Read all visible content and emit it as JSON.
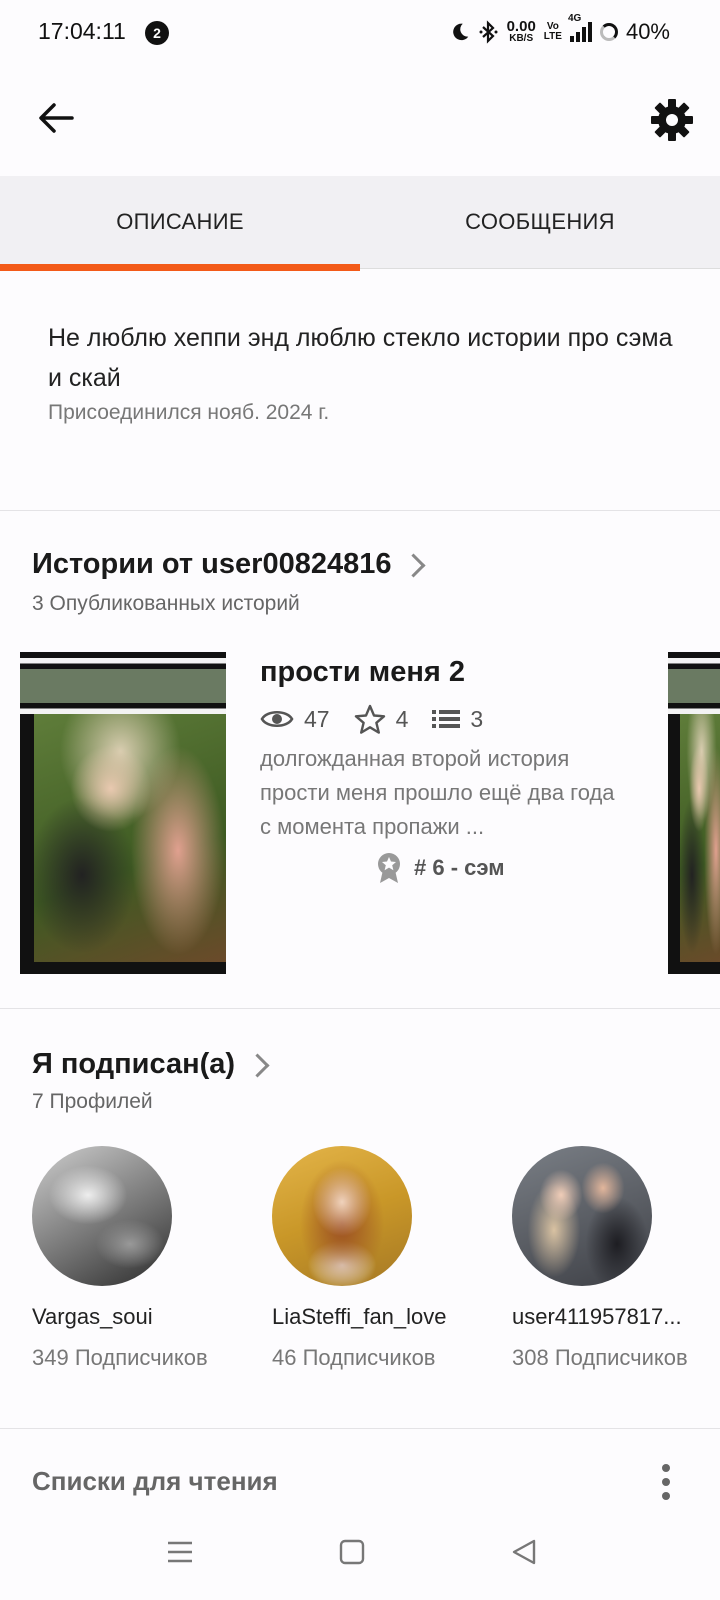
{
  "status_bar": {
    "time": "17:04:11",
    "notification_count": "2",
    "net_speed_value": "0.00",
    "net_speed_unit": "KB/S",
    "volte_top": "Vo",
    "volte_bottom": "LTE",
    "network": "4G",
    "battery": "40%"
  },
  "tabs": [
    {
      "label": "ОПИСАНИЕ",
      "active": true
    },
    {
      "label": "СООБЩЕНИЯ",
      "active": false
    }
  ],
  "about": {
    "bio": "Не люблю хеппи энд люблю стекло истории про сэма и скай",
    "joined": "Присоединился нояб. 2024 г."
  },
  "stories": {
    "title": "Истории от user00824816",
    "count_label": "3 Опубликованных историй",
    "items": [
      {
        "title": "прости меня 2",
        "reads": "47",
        "votes": "4",
        "parts": "3",
        "description": "долгожданная второй история прости меня прошло ещё два года с момента пропажи ...",
        "rank": "# 6 - сэм"
      }
    ]
  },
  "following": {
    "title": "Я подписан(а)",
    "count_label": "7 Профилей",
    "profiles": [
      {
        "name": "Vargas_soui",
        "followers": "349 Подписчиков"
      },
      {
        "name": "LiaSteffi_fan_love",
        "followers": "46 Подписчиков"
      },
      {
        "name": "user411957817...",
        "followers": "308 Подписчиков"
      }
    ]
  },
  "reading_lists": {
    "title": "Списки для чтения"
  },
  "colors": {
    "accent": "#f35a18",
    "background": "#fdfcfe",
    "tab_background": "#f1f0f3"
  },
  "icons": [
    "back-arrow-icon",
    "gear-icon",
    "eye-icon",
    "star-icon",
    "list-icon",
    "rank-badge-icon",
    "chevron-right-icon",
    "more-vertical-icon",
    "menu-icon",
    "home-square-icon",
    "back-triangle-icon"
  ]
}
